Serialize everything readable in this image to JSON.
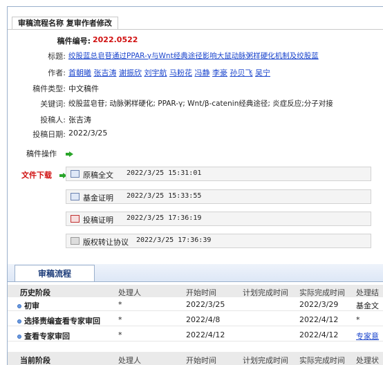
{
  "page": {
    "tab_title": "审稿流程名称 复审作者修改"
  },
  "manuscript": {
    "id_label": "稿件编号:",
    "id_value": "2022.0522",
    "title_label": "标题:",
    "title_value": "绞股蓝总皂苷通过PPAR-γ与Wnt经典途径影响大鼠动脉粥样硬化机制及绞股蓝",
    "authors_label": "作者:",
    "authors": [
      "首朝曦",
      "张吉涛",
      "谢振欣",
      "刘宇航",
      "马粉花",
      "冯静",
      "李豪",
      "孙贝飞",
      "吴宁"
    ],
    "type_label": "稿件类型:",
    "type_value": "中文稿件",
    "keywords_label": "关键词:",
    "keywords_value": "绞股蓝皂苷; 动脉粥样硬化; PPAR-γ; Wnt/β-catenin经典途径; 炎症反应;分子对接",
    "submitter_label": "投稿人:",
    "submitter_value": "张吉涛",
    "date_label": "投稿日期:",
    "date_value": "2022/3/25",
    "ops_label": "稿件操作"
  },
  "downloads": {
    "label": "文件下载",
    "files": [
      {
        "name": "原稿全文",
        "time": "2022/3/25 15:31:01",
        "icon": "word-doc-icon"
      },
      {
        "name": "基金证明",
        "time": "2022/3/25 15:33:55",
        "icon": "word-doc-icon"
      },
      {
        "name": "投稿证明",
        "time": "2022/3/25 17:36:19",
        "icon": "pdf-icon"
      },
      {
        "name": "版权转让协议",
        "time": "2022/3/25 17:36:39",
        "icon": "document-icon"
      }
    ]
  },
  "flow": {
    "tab_label": "审稿流程",
    "history_headers": [
      "历史阶段",
      "处理人",
      "开始时间",
      "计划完成时间",
      "实际完成时间",
      "处理结"
    ],
    "history_rows": [
      [
        "初审",
        "*",
        "2022/3/25",
        "",
        "2022/3/29",
        "基金文"
      ],
      [
        "选择责编查看专家审回",
        "*",
        "2022/4/8",
        "",
        "2022/4/12",
        "*"
      ],
      [
        "查看专家审回",
        "*",
        "2022/4/12",
        "",
        "2022/4/12",
        "专家意"
      ]
    ],
    "current_headers": [
      "当前阶段",
      "处理人",
      "开始时间",
      "计划完成时间",
      "实际完成时间",
      "处理状"
    ]
  }
}
